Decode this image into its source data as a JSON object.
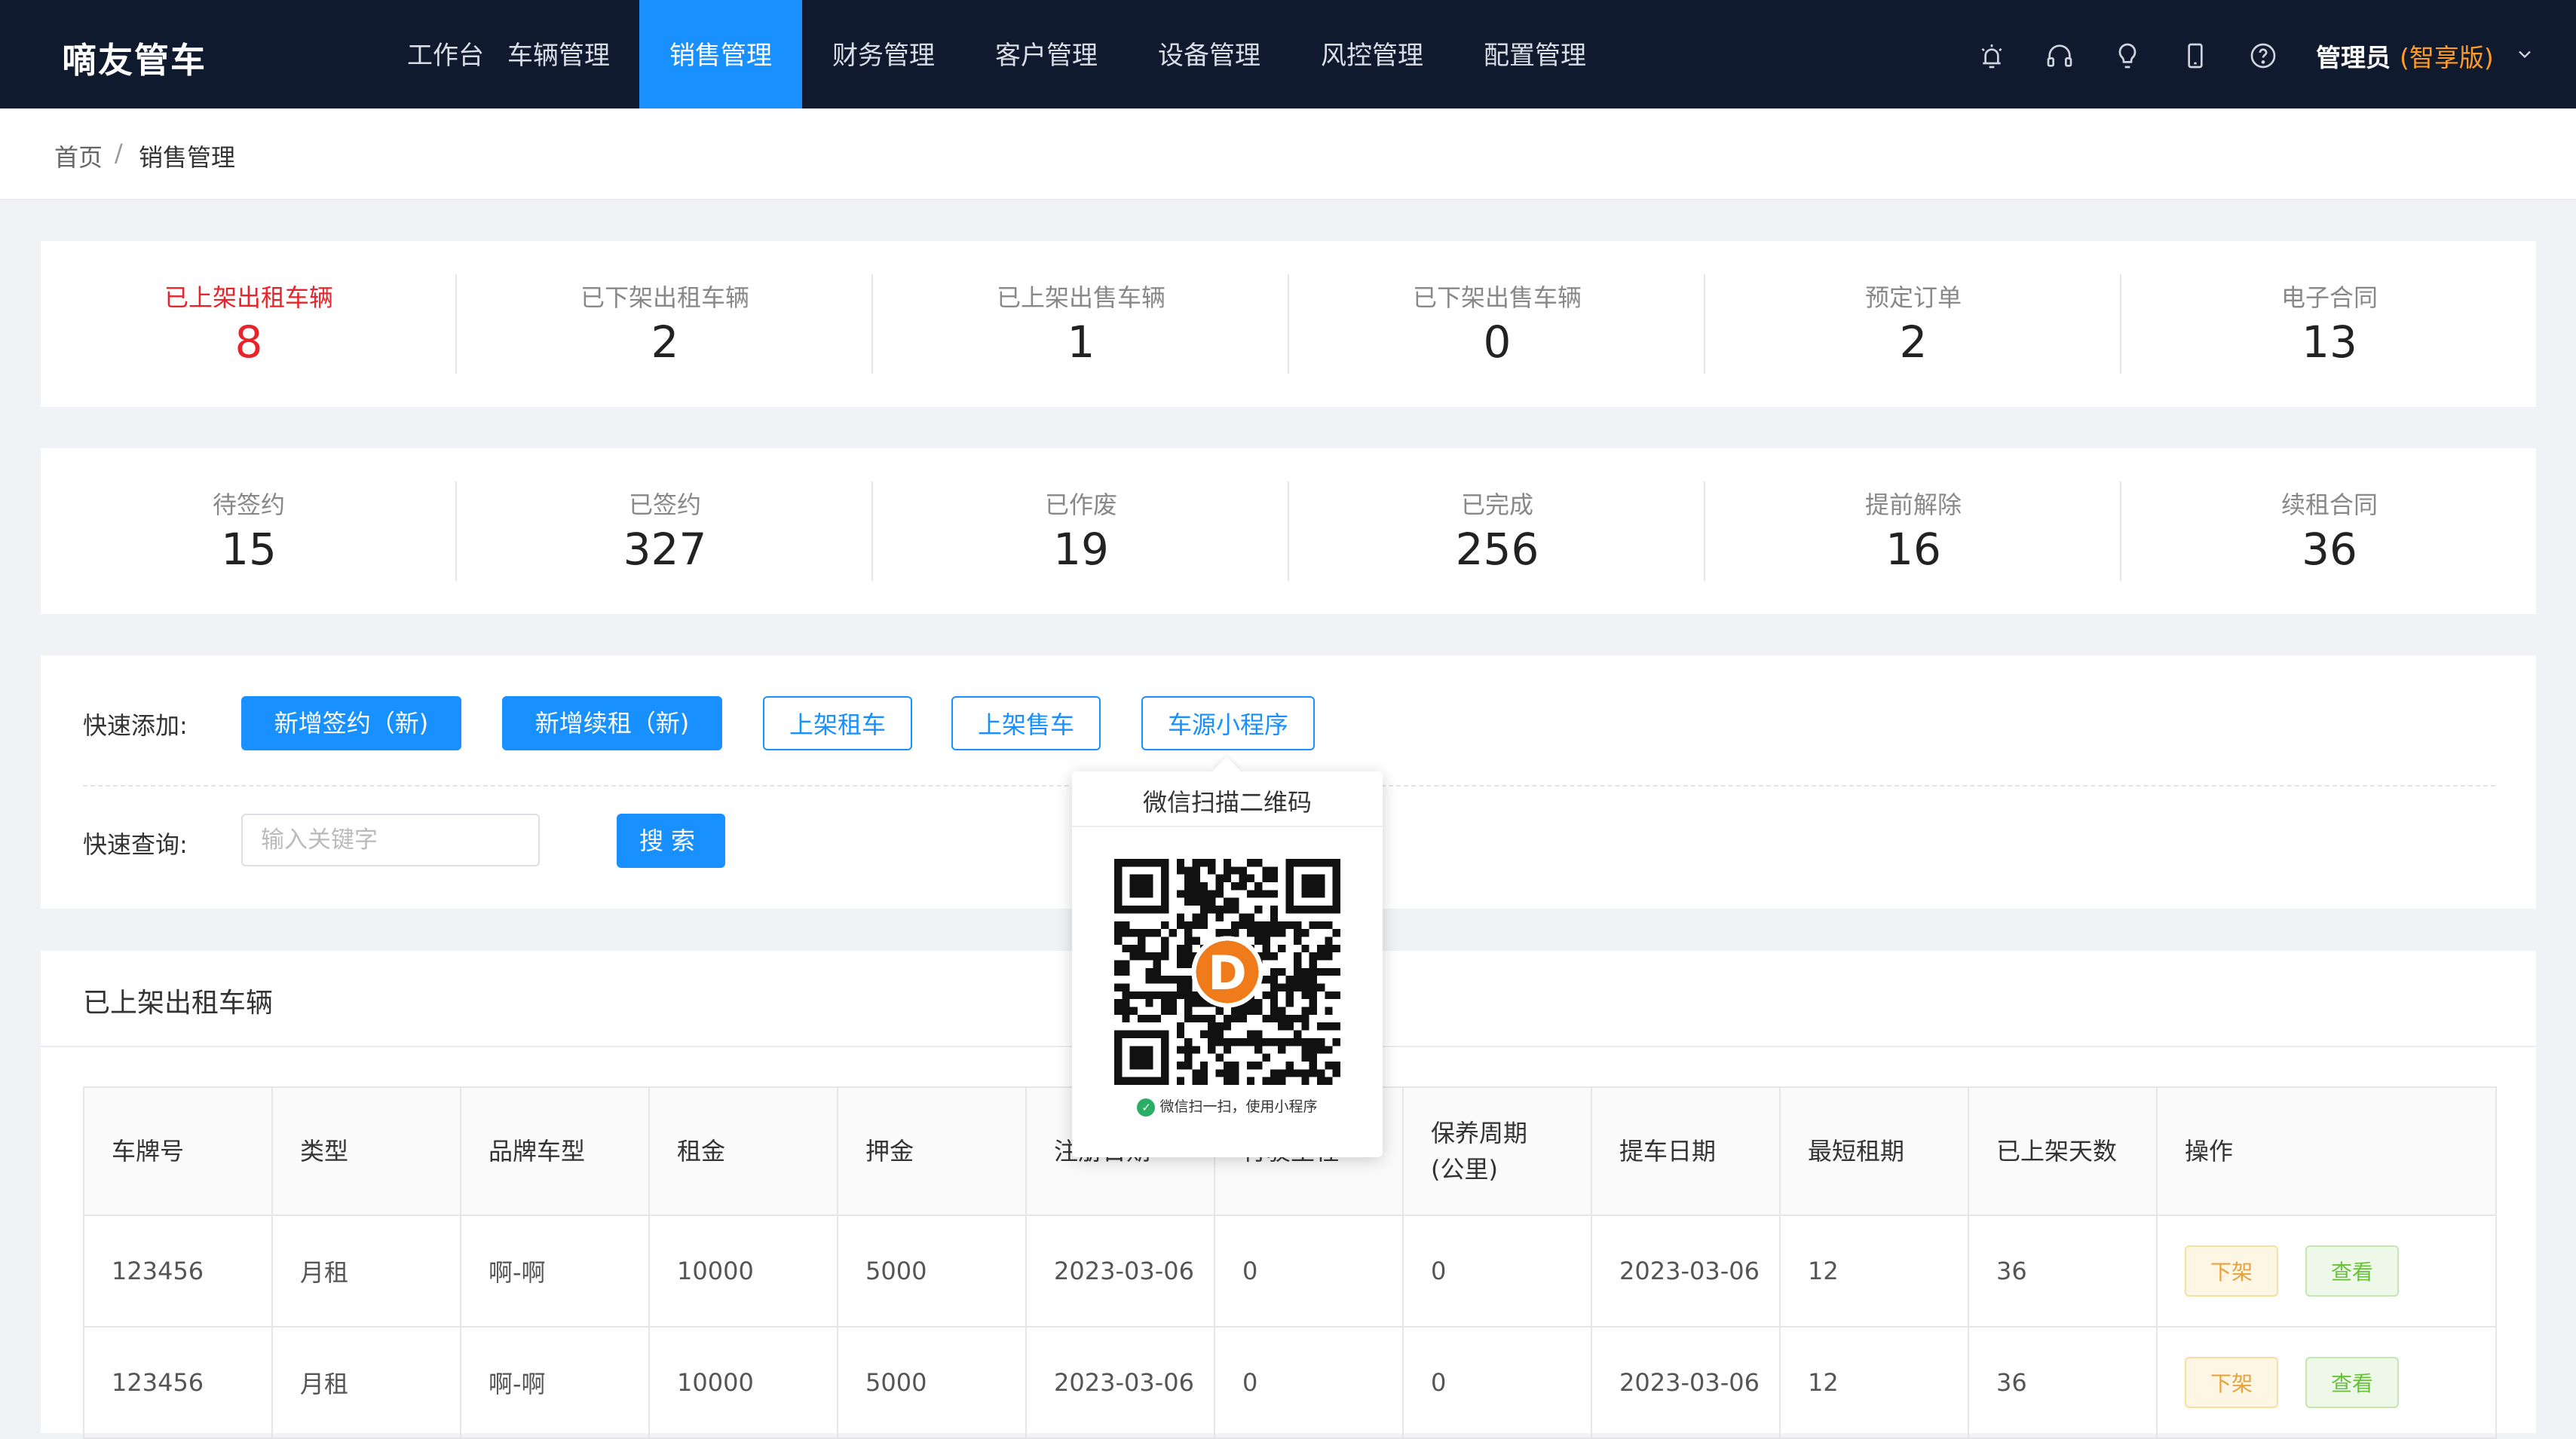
{
  "app": {
    "logo": "嘀友管车"
  },
  "nav": {
    "items": [
      {
        "label": "工作台"
      },
      {
        "label": "车辆管理"
      },
      {
        "label": "销售管理"
      },
      {
        "label": "财务管理"
      },
      {
        "label": "客户管理"
      },
      {
        "label": "设备管理"
      },
      {
        "label": "风控管理"
      },
      {
        "label": "配置管理"
      }
    ],
    "active_index": 2
  },
  "header_icons": [
    "alarm-icon",
    "headset-icon",
    "bulb-icon",
    "phone-icon",
    "help-icon"
  ],
  "user": {
    "name": "管理员",
    "edition": "(智享版)"
  },
  "breadcrumb": {
    "home": "首页",
    "separator": "/",
    "current": "销售管理"
  },
  "stats_row1": [
    {
      "label": "已上架出租车辆",
      "value": "8"
    },
    {
      "label": "已下架出租车辆",
      "value": "2"
    },
    {
      "label": "已上架出售车辆",
      "value": "1"
    },
    {
      "label": "已下架出售车辆",
      "value": "0"
    },
    {
      "label": "预定订单",
      "value": "2"
    },
    {
      "label": "电子合同",
      "value": "13"
    }
  ],
  "stats_row2": [
    {
      "label": "待签约",
      "value": "15"
    },
    {
      "label": "已签约",
      "value": "327"
    },
    {
      "label": "已作废",
      "value": "19"
    },
    {
      "label": "已完成",
      "value": "256"
    },
    {
      "label": "提前解除",
      "value": "16"
    },
    {
      "label": "续租合同",
      "value": "36"
    }
  ],
  "quick_add": {
    "label": "快速添加:",
    "buttons": [
      "新增签约（新)",
      "新增续租（新)",
      "上架租车",
      "上架售车",
      "车源小程序"
    ]
  },
  "quick_search": {
    "label": "快速查询:",
    "placeholder": "输入关键字",
    "button": "搜索"
  },
  "popover": {
    "title": "微信扫描二维码",
    "caption": "微信扫一扫，使用小程序"
  },
  "table": {
    "title": "已上架出租车辆",
    "columns": [
      "车牌号",
      "类型",
      "品牌车型",
      "租金",
      "押金",
      "注册日期",
      "行驶里程",
      "保养周期\n(公里)",
      "提车日期",
      "最短租期",
      "已上架天数",
      "操作"
    ],
    "rows": [
      [
        "123456",
        "月租",
        "啊-啊",
        "10000",
        "5000",
        "2023-03-06",
        "0",
        "0",
        "2023-03-06",
        "12",
        "36"
      ],
      [
        "123456",
        "月租",
        "啊-啊",
        "10000",
        "5000",
        "2023-03-06",
        "0",
        "0",
        "2023-03-06",
        "12",
        "36"
      ]
    ],
    "actions": {
      "offline": "下架",
      "view": "查看"
    }
  }
}
